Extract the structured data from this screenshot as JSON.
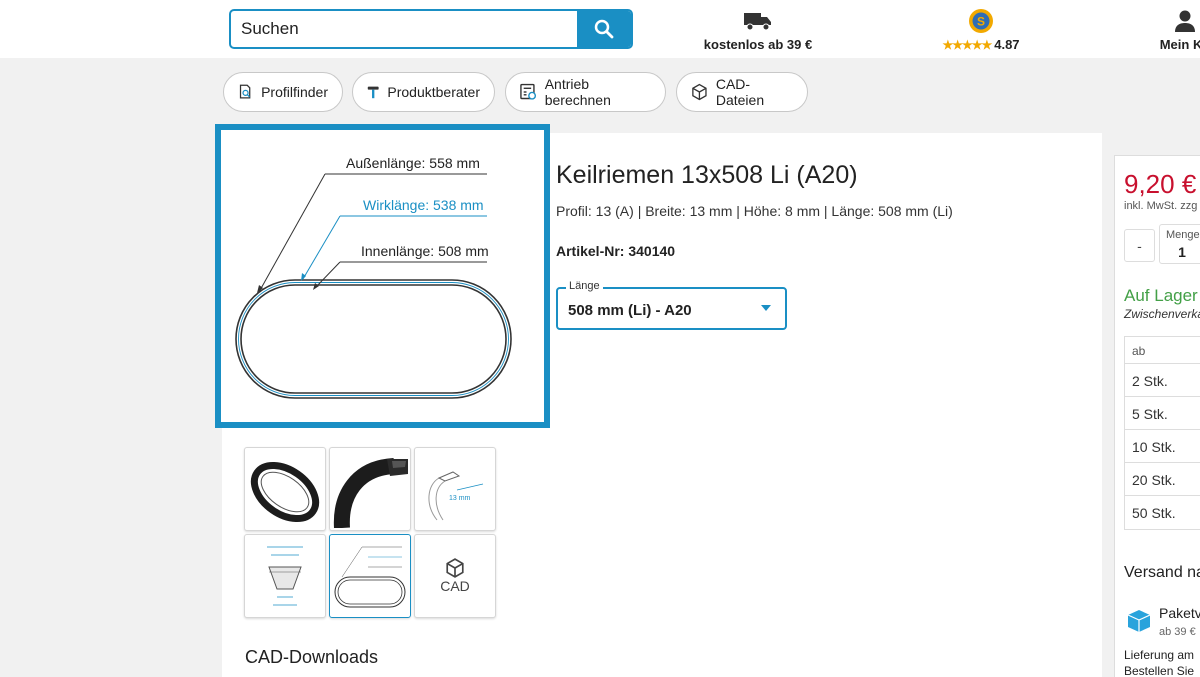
{
  "header": {
    "search_placeholder": "Suchen",
    "shipping_label": "kostenlos ab 39 €",
    "rating_stars": "★★★★★",
    "rating_value": "4.87",
    "account_label": "Mein Ko"
  },
  "chips": [
    {
      "label": "Profilfinder",
      "icon": "profile-search-icon"
    },
    {
      "label": "Produktberater",
      "icon": "advisor-icon"
    },
    {
      "label": "Antrieb berechnen",
      "icon": "calculator-icon"
    },
    {
      "label": "CAD-Dateien",
      "icon": "cube-icon"
    }
  ],
  "diagram": {
    "outer_length": "Außenlänge: 558 mm",
    "pitch_length": "Wirklänge: 538 mm",
    "inner_length": "Innenlänge: 508 mm"
  },
  "thumbnails": {
    "cad_label": "CAD",
    "thumb3_dim": "13 mm"
  },
  "cad_downloads_heading": "CAD-Downloads",
  "product": {
    "title": "Keilriemen 13x508 Li (A20)",
    "specs": "Profil: 13 (A) | Breite: 13 mm | Höhe: 8 mm | Länge: 508 mm (Li)",
    "article_nr": "Artikel-Nr: 340140",
    "length_label": "Länge",
    "length_value": "508 mm (Li) - A20"
  },
  "buy_panel": {
    "price": "9,20 €",
    "price_sub": "inkl. MwSt. zzg",
    "qty_minus": "-",
    "qty_label": "Menge",
    "qty_value": "1",
    "stock": "Auf Lager",
    "stock_sub": "Zwischenverka",
    "tier_header": "ab",
    "tiers": [
      "2 Stk.",
      "5 Stk.",
      "10 Stk.",
      "20 Stk.",
      "50 Stk."
    ],
    "versand_heading": "Versand na",
    "package_label": "Paketv",
    "package_sub": "ab 39 €",
    "delivery_line1": "Lieferung am",
    "delivery_line2": "Bestellen Sie"
  },
  "colors": {
    "accent": "#1a8fc4",
    "price": "#c8102e",
    "stock": "#43a047",
    "stars": "#f2a900"
  }
}
